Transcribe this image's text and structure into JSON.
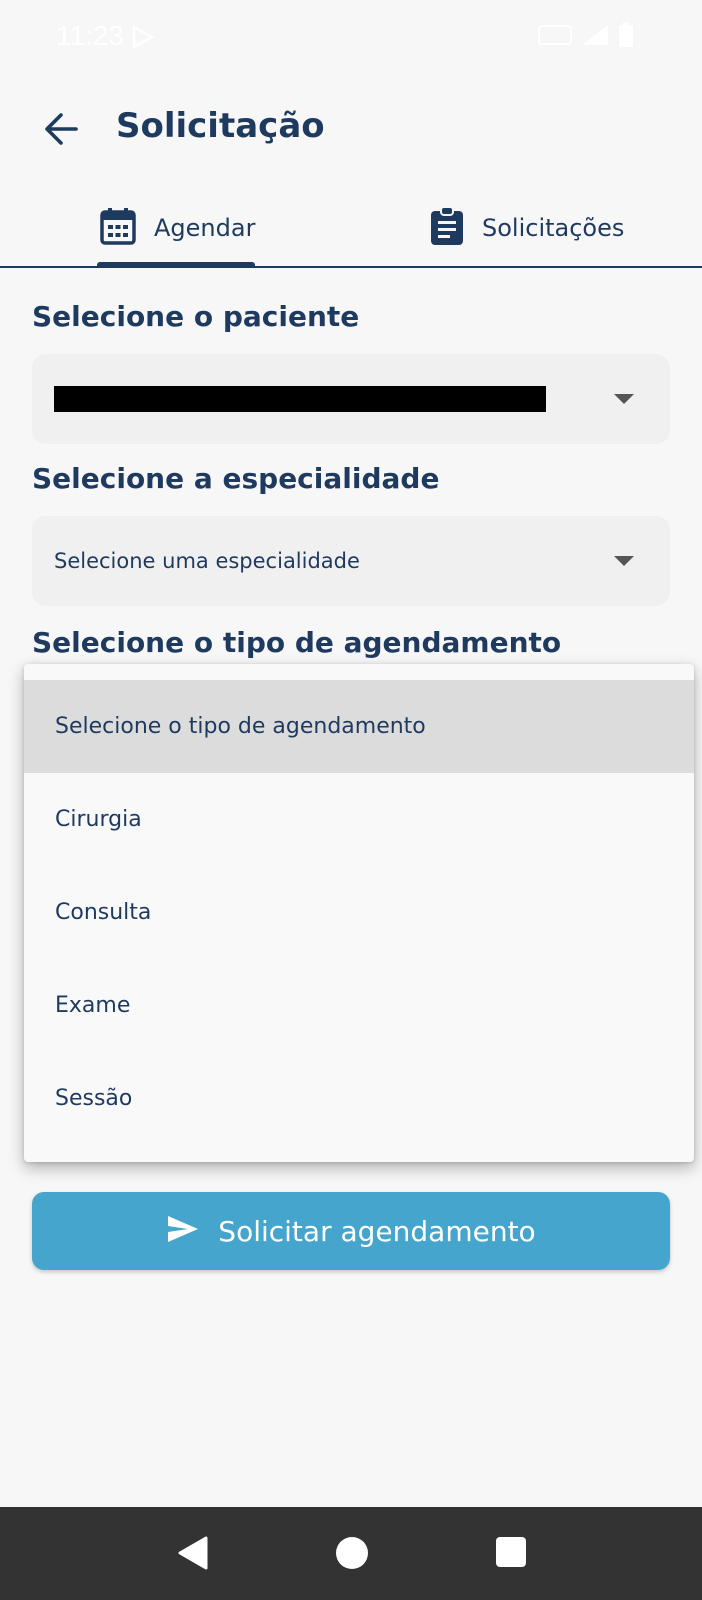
{
  "status_bar": {
    "time": "11:23"
  },
  "header": {
    "title": "Solicitação"
  },
  "tabs": [
    {
      "label": "Agendar",
      "icon": "calendar-icon",
      "active": true
    },
    {
      "label": "Solicitações",
      "icon": "clipboard-icon",
      "active": false
    }
  ],
  "form": {
    "patient_label": "Selecione o paciente",
    "specialty_label": "Selecione a especialidade",
    "specialty_placeholder": "Selecione uma especialidade",
    "type_label": "Selecione o tipo de agendamento"
  },
  "dropdown": {
    "options": [
      "Selecione o tipo de agendamento",
      "Cirurgia",
      "Consulta",
      "Exame",
      "Sessão"
    ],
    "selected_index": 0
  },
  "submit": {
    "label": "Solicitar agendamento",
    "icon": "send-icon"
  },
  "colors": {
    "primary": "#1f3a5f",
    "accent": "#45a5cc",
    "background": "#f7f7f8",
    "nav_bar": "#333333"
  }
}
